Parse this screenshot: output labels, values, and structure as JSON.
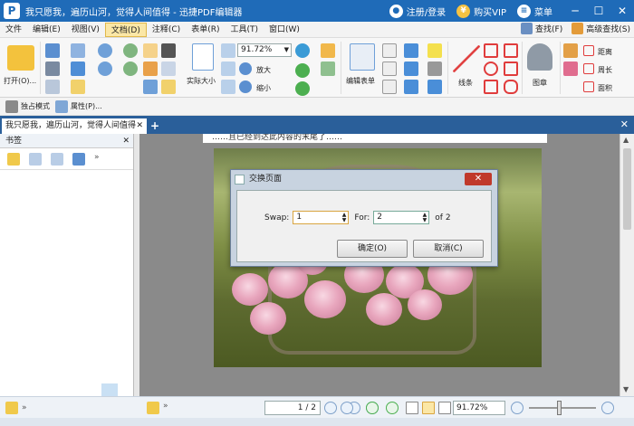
{
  "titlebar": {
    "title": "我只愿我，遍历山河，觉得人间值得 - 迅捷PDF编辑器",
    "login": "注册/登录",
    "vip": "购买VIP",
    "menu": "菜单"
  },
  "menubar": {
    "items": [
      "文件",
      "编辑(E)",
      "视图(V)",
      "文档(D)",
      "注释(C)",
      "表单(R)",
      "工具(T)",
      "窗口(W)"
    ],
    "active_index": 3,
    "find": "查找(F)",
    "advanced_search": "高级查找(S)"
  },
  "ribbon": {
    "open": "打开(O)...",
    "zoom": "91.72%",
    "actual_size": "实际大小",
    "zoom_in": "放大",
    "zoom_out": "缩小",
    "edit_form": "编辑表单",
    "lines": "线条",
    "stamp": "图章",
    "distance": "距离",
    "perimeter": "周长",
    "area": "面积"
  },
  "quickbar": {
    "exclusive_mode": "独占模式",
    "properties": "属性(P)..."
  },
  "tabs": {
    "doc_tab": "我只愿我，遍历山河，觉得人间值得"
  },
  "leftpanel": {
    "title": "书签"
  },
  "page": {
    "top_text": "……且已经到达此内容的末尾了……"
  },
  "dialog": {
    "title": "交换页面",
    "swap_label": "Swap:",
    "swap_value": "1",
    "for_label": "For:",
    "for_value": "2",
    "of_text": "of 2",
    "ok": "确定(O)",
    "cancel": "取消(C)"
  },
  "statusbar": {
    "page": "1 / 2",
    "zoom": "91.72%"
  },
  "colors": {
    "titlebar": "#1f6bb8",
    "tabbar": "#2a5f9a",
    "dialog_frame": "#c8d3e0",
    "close_red": "#c0392b"
  }
}
